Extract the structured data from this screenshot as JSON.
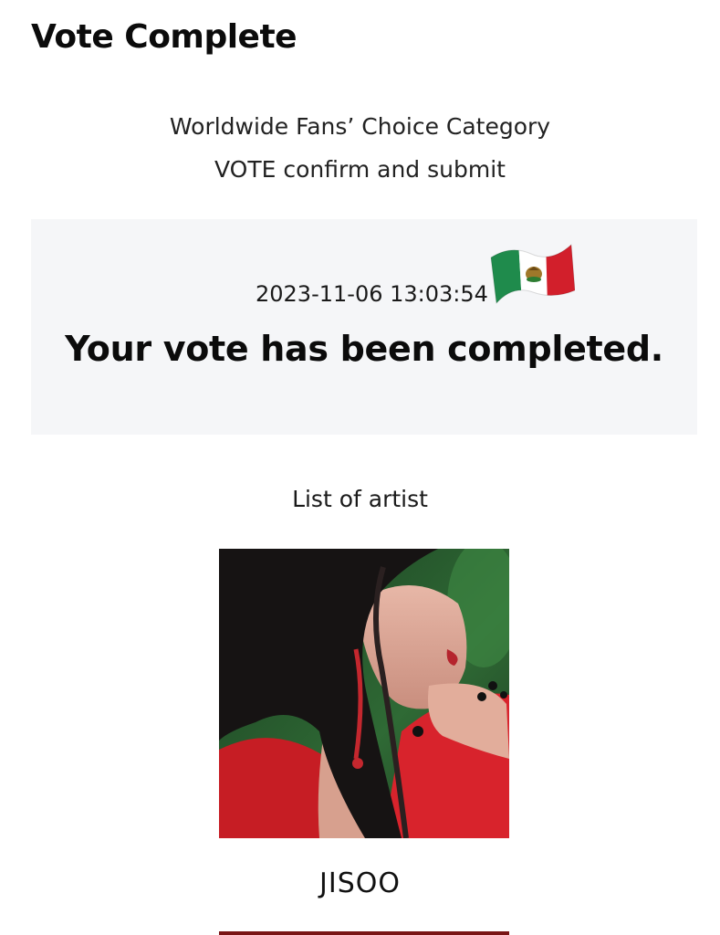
{
  "page": {
    "title": "Vote Complete"
  },
  "category": {
    "name": "Worldwide Fans’ Choice Category",
    "step": "VOTE confirm and submit"
  },
  "result": {
    "timestamp": "2023-11-06 13:03:54",
    "flag_icon": "mexico-flag-icon",
    "message": "Your vote has been completed."
  },
  "artists": {
    "label": "List of artist",
    "items": [
      {
        "name": "JISOO"
      }
    ]
  },
  "colors": {
    "result_box_bg": "#f5f6f8",
    "text": "#111111",
    "flag_green": "#1f8b4c",
    "flag_white": "#ffffff",
    "flag_red": "#d21f2b"
  }
}
